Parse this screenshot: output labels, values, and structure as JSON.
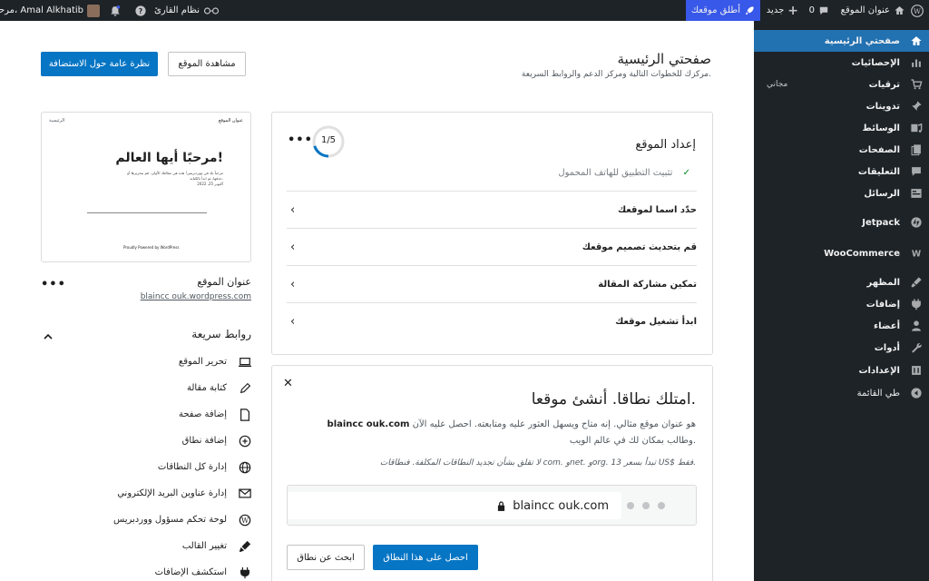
{
  "adminbar": {
    "site_name": "عنوان الموقع",
    "comments_count": "0",
    "new_label": "جديد",
    "launch_label": "أطلق موقعك",
    "reader_label": "نظام القارئ",
    "greeting": "مرحبًا، Amal Alkhatib"
  },
  "sidebar": {
    "items": [
      {
        "label": "صفحتي الرئيسية",
        "icon": "home-icon"
      },
      {
        "label": "الإحصائيات",
        "icon": "stats-icon"
      },
      {
        "label": "ترقيات",
        "icon": "cart-icon"
      },
      {
        "label": "تدوينات",
        "icon": "pin-icon"
      },
      {
        "label": "الوسائط",
        "icon": "media-icon"
      },
      {
        "label": "الصفحات",
        "icon": "pages-icon"
      },
      {
        "label": "التعليقات",
        "icon": "comments-icon"
      },
      {
        "label": "الرسائل",
        "icon": "feedback-icon"
      },
      {
        "label": "Jetpack",
        "icon": "jetpack-icon"
      },
      {
        "label": "WooCommerce",
        "icon": "woo-icon"
      },
      {
        "label": "المظهر",
        "icon": "appearance-icon"
      },
      {
        "label": "إضافات",
        "icon": "plugins-icon"
      },
      {
        "label": "أعضاء",
        "icon": "users-icon"
      },
      {
        "label": "أدوات",
        "icon": "tools-icon"
      },
      {
        "label": "الإعدادات",
        "icon": "settings-icon"
      },
      {
        "label": "طي القائمة",
        "icon": "collapse-icon"
      }
    ],
    "upgrades_badge": "مجاني"
  },
  "header": {
    "title": "صفحتي الرئيسية",
    "subtitle": "مركزك للخطوات التالية ومركز الدعم والروابط السريعة.",
    "view_site": "مشاهدة الموقع",
    "hosting_overview": "نظرة عامة حول الاستضافة"
  },
  "site_card": {
    "preview_site_title": "عنوان الموقع",
    "preview_nav": "الرئيسية",
    "preview_heading": "مرحبًا أيها العالم!",
    "preview_line1": "مرحباً بك في ووردبريس! هذه هي مقالتك الأولى. قم بتحريرها أو",
    "preview_line2": "حذفها، ثم ابدأ بالكتابة.",
    "preview_date": "أكتوبر 25، 2022",
    "preview_footer": "Proudly Powered by WordPress",
    "name": "عنوان الموقع",
    "url": "blaincc ouk.wordpress.com"
  },
  "setup": {
    "title": "إعداد الموقع",
    "progress_label": "1/5",
    "progress_fraction": 0.2,
    "completed_task": "تثبيت التطبيق للهاتف المحمول",
    "tasks": [
      "حدّد اسما لموقعك",
      "قم بتحديث تصميم موقعك",
      "تمكين مشاركة المقالة",
      "ابدأ تشغيل موقعك"
    ]
  },
  "domain": {
    "title": "امتلك نطاقا. أنشئ موقعا.",
    "domain_name": "blaincc ouk.com",
    "desc_rest": "هو عنوان موقع مثالي. إنه متاح ويسهل العثور عليه ومتابعته. احصل عليه الآن",
    "desc_line2": "وطالب بمكان لك في عالم الويب.",
    "note": "لا تقلق بشأن تجديد النطاقات المكلفة. فنطاقات com. وnet. وorg. تبدأ بسعر 13 US$ فقط.",
    "url_display": "blaincc ouk.com",
    "cta_primary": "احصل على هذا النطاق",
    "cta_secondary": "ابحث عن نطاق"
  },
  "quick_links": {
    "title": "روابط سريعة",
    "items": [
      {
        "label": "تحرير الموقع",
        "icon": "laptop-icon"
      },
      {
        "label": "كتابة مقالة",
        "icon": "pencil-icon"
      },
      {
        "label": "إضافة صفحة",
        "icon": "page-icon"
      },
      {
        "label": "إضافة نطاق",
        "icon": "plus-circle-icon"
      },
      {
        "label": "إدارة كل النطاقات",
        "icon": "globe-icon"
      },
      {
        "label": "إدارة عناوين البريد الإلكتروني",
        "icon": "mail-icon"
      },
      {
        "label": "لوحة تحكم مسؤول ووردبريس",
        "icon": "wordpress-icon"
      },
      {
        "label": "تغيير القالب",
        "icon": "brush-icon"
      },
      {
        "label": "استكشف الإضافات",
        "icon": "plug-icon"
      }
    ]
  },
  "colors": {
    "accent": "#0675c4",
    "admin_bar": "#1d2327",
    "launch": "#3858e9",
    "active_menu": "#2271b1"
  }
}
